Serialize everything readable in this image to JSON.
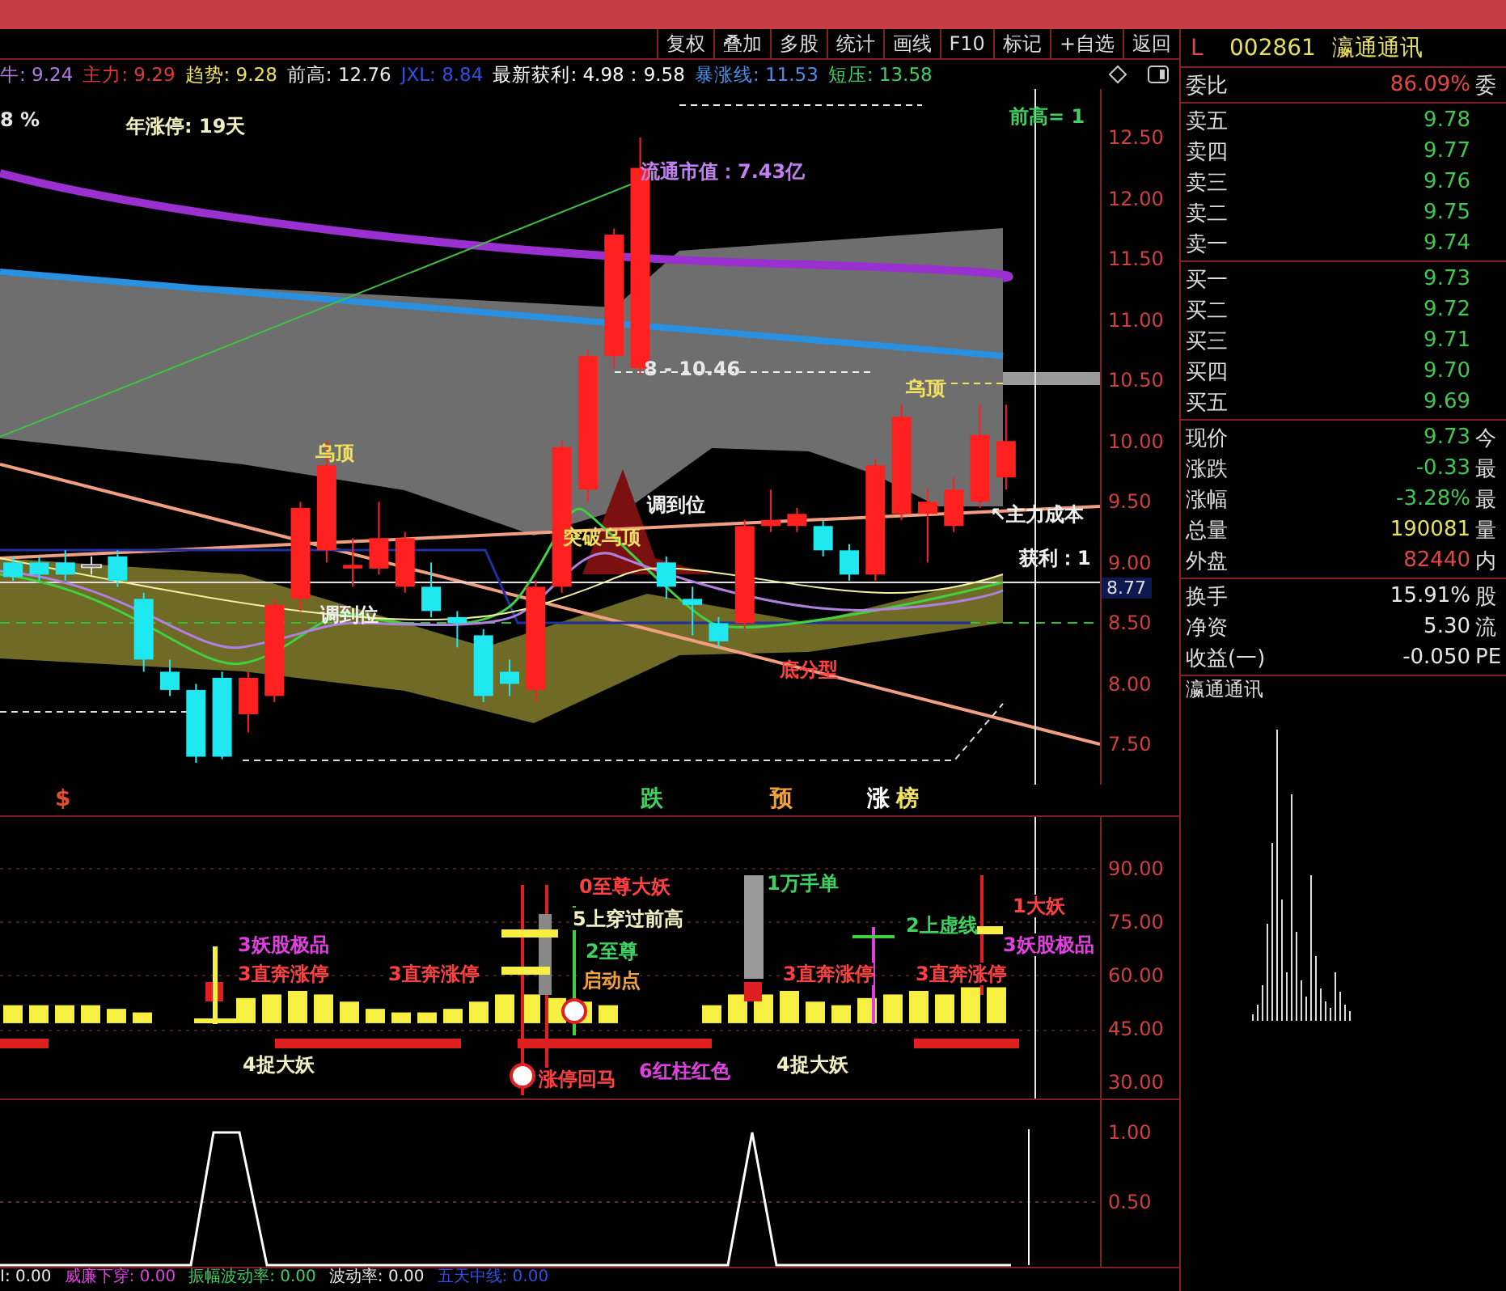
{
  "toolbar": {
    "buttons": [
      "复权",
      "叠加",
      "多股",
      "统计",
      "画线",
      "F10",
      "标记",
      "+自选",
      "返回"
    ]
  },
  "indicators": [
    {
      "label": "牛:",
      "value": "9.24",
      "color": "#b07ae0"
    },
    {
      "label": "主力:",
      "value": "9.29",
      "color": "#e03a3a"
    },
    {
      "label": "趋势:",
      "value": "9.28",
      "color": "#f0e060"
    },
    {
      "label": "前高:",
      "value": "12.76",
      "color": "#e8e8e8"
    },
    {
      "label": "JXL:",
      "value": "8.84",
      "color": "#3050e0"
    },
    {
      "label": "最新获利:",
      "value": "4.98：9.58",
      "color": "#ffffff"
    },
    {
      "label": "暴涨线:",
      "value": "11.53",
      "color": "#4a8ee8"
    },
    {
      "label": "短压:",
      "value": "13.58",
      "color": "#40d060"
    }
  ],
  "main_chart": {
    "price_tag": "8.77",
    "chart_data": {
      "type": "candlestick",
      "ohlc": [
        [
          9.0,
          9.05,
          8.85,
          8.88
        ],
        [
          9.0,
          9.05,
          8.85,
          8.9
        ],
        [
          9.0,
          9.1,
          8.85,
          8.9
        ],
        [
          8.98,
          9.05,
          8.9,
          8.98
        ],
        [
          9.05,
          9.1,
          8.8,
          8.85
        ],
        [
          8.7,
          8.75,
          8.1,
          8.2
        ],
        [
          8.1,
          8.2,
          7.9,
          7.95
        ],
        [
          7.95,
          8.0,
          7.35,
          7.4
        ],
        [
          8.05,
          8.1,
          7.38,
          7.4
        ],
        [
          7.75,
          8.1,
          7.6,
          8.05
        ],
        [
          7.9,
          8.7,
          7.85,
          8.65
        ],
        [
          8.7,
          9.5,
          8.6,
          9.45
        ],
        [
          9.1,
          10.0,
          9.0,
          9.8
        ],
        [
          8.95,
          9.2,
          8.8,
          8.98
        ],
        [
          8.95,
          9.5,
          8.9,
          9.2
        ],
        [
          8.8,
          9.25,
          8.75,
          9.2
        ],
        [
          8.8,
          9.0,
          8.55,
          8.6
        ],
        [
          8.55,
          8.6,
          8.3,
          8.5
        ],
        [
          8.4,
          8.45,
          7.85,
          7.9
        ],
        [
          8.1,
          8.2,
          7.9,
          8.0
        ],
        [
          7.95,
          8.85,
          7.85,
          8.8
        ],
        [
          8.8,
          10.0,
          8.75,
          9.95
        ],
        [
          9.6,
          10.75,
          9.5,
          10.7
        ],
        [
          10.7,
          11.75,
          10.6,
          11.7
        ],
        [
          10.6,
          12.5,
          10.55,
          12.25
        ],
        [
          9.0,
          9.05,
          8.7,
          8.8
        ],
        [
          8.7,
          8.8,
          8.4,
          8.65
        ],
        [
          8.5,
          8.55,
          8.3,
          8.35
        ],
        [
          8.5,
          9.35,
          8.45,
          9.3
        ],
        [
          9.3,
          9.6,
          9.25,
          9.35
        ],
        [
          9.3,
          9.45,
          9.25,
          9.4
        ],
        [
          9.3,
          9.35,
          9.05,
          9.1
        ],
        [
          9.1,
          9.15,
          8.85,
          8.9
        ],
        [
          8.9,
          9.85,
          8.85,
          9.8
        ],
        [
          9.4,
          10.3,
          9.35,
          10.2
        ],
        [
          9.4,
          9.6,
          9.0,
          9.5
        ],
        [
          9.3,
          9.7,
          9.25,
          9.6
        ],
        [
          9.5,
          10.3,
          9.45,
          10.05
        ],
        [
          9.7,
          10.3,
          9.6,
          10.0
        ]
      ],
      "ylim": [
        7.17,
        12.9
      ],
      "yticks": [
        {
          "value": 12.5,
          "label": "12.50"
        },
        {
          "value": 12.0,
          "label": "12.00"
        },
        {
          "value": 11.5,
          "label": "11.50"
        },
        {
          "value": 11.0,
          "label": "11.00"
        },
        {
          "value": 10.5,
          "label": "10.50"
        },
        {
          "value": 10.0,
          "label": "10.00"
        },
        {
          "value": 9.5,
          "label": "9.50"
        },
        {
          "value": 9.0,
          "label": "9.00"
        },
        {
          "value": 8.5,
          "label": "8.50"
        },
        {
          "value": 8.0,
          "label": "8.00"
        },
        {
          "value": 7.5,
          "label": "7.50"
        }
      ]
    },
    "annotations": [
      {
        "text": "8 %",
        "color": "#e8e8e8"
      },
      {
        "text": "年涨停: 19天",
        "color": "#f0f0c0"
      },
      {
        "text": "前高= 1",
        "color": "#40d060"
      },
      {
        "text": "流通市值：7.43亿",
        "color": "#c080f0"
      },
      {
        "text": "8 - 10.46",
        "color": "#e8e8e8"
      },
      {
        "text": "乌顶",
        "color": "#f0e060"
      },
      {
        "text": "乌顶",
        "color": "#f0e060"
      },
      {
        "text": "调到位",
        "color": "#f0f0f0"
      },
      {
        "text": "突破乌顶",
        "color": "#f0e060"
      },
      {
        "text": "调到位",
        "color": "#f0f0f0"
      },
      {
        "text": "底分型",
        "color": "#ff4040"
      },
      {
        "text": "↖主力成本",
        "color": "#f0f0f0"
      },
      {
        "text": "获利：1",
        "color": "#f0f0f0"
      }
    ]
  },
  "signal_strip": [
    {
      "text": "$",
      "color": "#e05030"
    },
    {
      "text": "跌",
      "color": "#40d060"
    },
    {
      "text": "预",
      "color": "#f0a040"
    },
    {
      "text": "涨",
      "color": "#ffffff"
    },
    {
      "text": "榜",
      "color": "#f0e060"
    }
  ],
  "sub_chart_1": {
    "y_axis": [
      "90.00",
      "75.00",
      "60.00",
      "45.00",
      "30.00"
    ],
    "labels": [
      {
        "text": "0至尊大妖",
        "color": "#ff4040"
      },
      {
        "text": "5上穿过前高",
        "color": "#f0f0c0"
      },
      {
        "text": "2至尊",
        "color": "#40d060"
      },
      {
        "text": "启动点",
        "color": "#f0a040"
      },
      {
        "text": "1万手单",
        "color": "#40d060"
      },
      {
        "text": "2上虚线",
        "color": "#40d060"
      },
      {
        "text": "1大妖",
        "color": "#ff4040"
      },
      {
        "text": "3妖股极品",
        "color": "#e040e0"
      },
      {
        "text": "3妖股极品",
        "color": "#e040e0"
      },
      {
        "text": "3直奔涨停",
        "color": "#ff4040"
      },
      {
        "text": "3直奔涨停",
        "color": "#ff4040"
      },
      {
        "text": "3直奔涨停",
        "color": "#ff4040"
      },
      {
        "text": "3直奔涨停",
        "color": "#ff4040"
      },
      {
        "text": "4捉大妖",
        "color": "#f0f0c0"
      },
      {
        "text": "6红柱红色",
        "color": "#e040e0"
      },
      {
        "text": "4捉大妖",
        "color": "#f0f0c0"
      },
      {
        "text": "涨停回马",
        "color": "#ff4040"
      }
    ]
  },
  "sub_chart_2": {
    "y_axis": [
      "1.00",
      "0.50"
    ]
  },
  "bottom_readouts": [
    {
      "label": "I: 0.00",
      "color": "#e8e8e8"
    },
    {
      "label": "威廉下穿: 0.00",
      "color": "#e040e0"
    },
    {
      "label": "振幅波动率: 0.00",
      "color": "#40d060"
    },
    {
      "label": "波动率: 0.00",
      "color": "#e8e8e8"
    },
    {
      "label": "五天中线: 0.00",
      "color": "#3050e0"
    }
  ],
  "quote_panel": {
    "marker": "L",
    "code": "002861",
    "name": "瀛通通讯",
    "groups": [
      [
        {
          "label": "委比",
          "value": "86.09%",
          "color": "#e04848",
          "extra": "委"
        }
      ],
      [
        {
          "label": "卖五",
          "value": "9.78",
          "color": "#40c850"
        },
        {
          "label": "卖四",
          "value": "9.77",
          "color": "#40c850"
        },
        {
          "label": "卖三",
          "value": "9.76",
          "color": "#40c850"
        },
        {
          "label": "卖二",
          "value": "9.75",
          "color": "#40c850"
        },
        {
          "label": "卖一",
          "value": "9.74",
          "color": "#40c850"
        }
      ],
      [
        {
          "label": "买一",
          "value": "9.73",
          "color": "#40c850"
        },
        {
          "label": "买二",
          "value": "9.72",
          "color": "#40c850"
        },
        {
          "label": "买三",
          "value": "9.71",
          "color": "#40c850"
        },
        {
          "label": "买四",
          "value": "9.70",
          "color": "#40c850"
        },
        {
          "label": "买五",
          "value": "9.69",
          "color": "#40c850"
        }
      ],
      [
        {
          "label": "现价",
          "value": "9.73",
          "color": "#40c850",
          "extra": "今"
        },
        {
          "label": "涨跌",
          "value": "-0.33",
          "color": "#40c850",
          "extra": "最"
        },
        {
          "label": "涨幅",
          "value": "-3.28%",
          "color": "#40c850",
          "extra": "最"
        },
        {
          "label": "总量",
          "value": "190081",
          "color": "#e8e060",
          "extra": "量"
        },
        {
          "label": "外盘",
          "value": "82440",
          "color": "#e04848",
          "extra": "内"
        }
      ],
      [
        {
          "label": "换手",
          "value": "15.91%",
          "color": "#e8e8e8",
          "extra": "股"
        },
        {
          "label": "净资",
          "value": "5.30",
          "color": "#e8e8e8",
          "extra": "流"
        },
        {
          "label": "收益(一)",
          "value": "-0.050",
          "color": "#e8e8e8",
          "extra": "PE"
        }
      ]
    ],
    "footer": "瀛通通讯"
  }
}
